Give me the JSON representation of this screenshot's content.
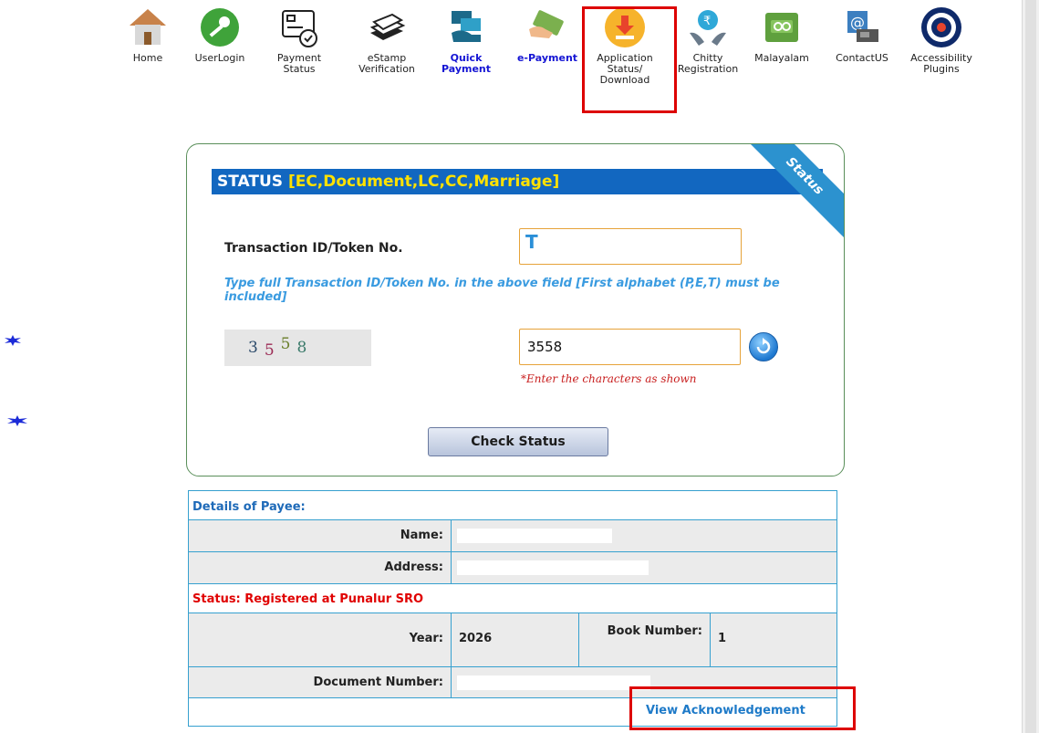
{
  "nav": {
    "items": [
      {
        "label": "Home",
        "icon": "home-icon"
      },
      {
        "label": "UserLogin",
        "icon": "key-icon"
      },
      {
        "label": "Payment Status",
        "icon": "payment-status-icon"
      },
      {
        "label": "eStamp Verification",
        "icon": "stamp-papers-icon"
      },
      {
        "label": "Quick Payment",
        "icon": "card-payment-icon"
      },
      {
        "label": "e-Payment",
        "icon": "cash-payment-icon"
      },
      {
        "label": "Application Status/ Download",
        "icon": "download-icon"
      },
      {
        "label": "Chitty Registration",
        "icon": "rupee-hands-icon"
      },
      {
        "label": "Malayalam",
        "icon": "malayalam-keyboard-icon"
      },
      {
        "label": "ContactUS",
        "icon": "contact-phone-icon"
      },
      {
        "label": "Accessibility Plugins",
        "icon": "eye-icon"
      }
    ]
  },
  "status_panel": {
    "heading": "STATUS",
    "heading_types": "[EC,Document,LC,CC,Marriage]",
    "ribbon": "Status",
    "tx_label": "Transaction ID/Token No.",
    "tx_value": "T",
    "hint": "Type full Transaction ID/Token No. in the above field [First alphabet (P,E,T) must be included]",
    "captcha_chars": [
      "3",
      "5",
      "5",
      "8"
    ],
    "captcha_value": "3558",
    "captcha_note": "*Enter the characters as shown",
    "check_button": "Check Status"
  },
  "details": {
    "title": "Details of Payee:",
    "name_label": "Name:",
    "address_label": "Address:",
    "status": "Status: Registered at Punalur SRO",
    "year_label": "Year:",
    "year_value": "2026",
    "book_label": "Book Number:",
    "book_value": "1",
    "doc_label": "Document Number:",
    "view_ack": "View Acknowledgement"
  },
  "colors": {
    "header_blue": "#1267c0",
    "header_yellow": "#ffe100",
    "highlight_red": "#dd0000",
    "status_red": "#e00000",
    "link_blue": "#1e7ac8"
  }
}
